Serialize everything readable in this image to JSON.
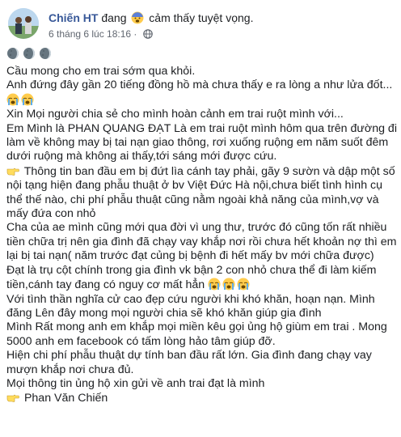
{
  "post": {
    "author": "Chiến HT",
    "status_prefix": "đang",
    "status_feeling": "cảm thấy tuyệt vọng.",
    "timestamp": "6 tháng 6 lúc 18:16 ·",
    "privacy_icon": "globe-icon",
    "feeling_icon": "anguished-face-icon",
    "lines": [
      "Cầu mong cho em trai sớm qua khỏi.",
      "Anh đứng đây gần 20 tiếng đồng hồ mà chưa thấy e ra lòng a như lửa đốt...",
      "Xin Mọi người chia sẻ cho mình hoàn cảnh em trai ruột mình với...",
      "Em Mình là PHAN QUANG ĐẠT Là em trai ruột mình hôm qua trên đường đi làm về không may bị tai nạn giao thông, rơi xuống ruộng em năm suốt đêm dưới ruộng mà không ai thấy,tới sáng mới được cứu.",
      "Thông tin ban đầu em bị đứt lìa cánh tay phải, gãy 9 sườn và dập một số nội tạng hiện đang phẫu thuật ở bv Việt Đức Hà nội,chưa biết tình hình cụ thể thế nào, chi phí phẫu thuật cũng nằm ngoài khả năng của mình,vợ và mấy đứa con nhỏ",
      "Cha của ae mình cũng mới qua đời vì ung thư, trước đó cũng tốn rất nhiều tiền chữa trị nên gia đình đã chạy vay khắp nơi rồi chưa hết khoản nợ thì em lại bị tai nạn( năm trước đạt củng bị bệnh đi hết mấy bv mới chữa được)",
      "Đạt là trụ cột chính trong gia đình vk bận 2 con nhỏ chưa thể đi làm kiếm tiền,cánh tay đang có nguy cơ mất hẳn",
      "Với tình thần nghĩa cử cao đẹp cứu người khi khó khăn, hoạn nạn. Mình đăng Lên đây mong mọi người chia sẽ khó khăn giúp gia đình",
      "Mình Rất mong anh em khắp mọi miền kêu gọi ủng hộ giùm em trai . Mong 5000 anh em facebook có tấm lòng hảo tâm giúp đỡ.",
      "Hiện chi phí phẫu thuật dự tính ban đầu rất lớn. Gia đình đang chạy vay mượn khắp nơi chưa đủ.",
      "Mọi thông tin ủng hộ xin gửi về anh trai đạt là mình",
      "Phan Văn Chiến"
    ],
    "emoji_names": {
      "cry": "loudly-crying-face-icon",
      "crescent": "waning-crescent-moon-icon",
      "point": "backhand-index-pointing-right-icon"
    }
  }
}
